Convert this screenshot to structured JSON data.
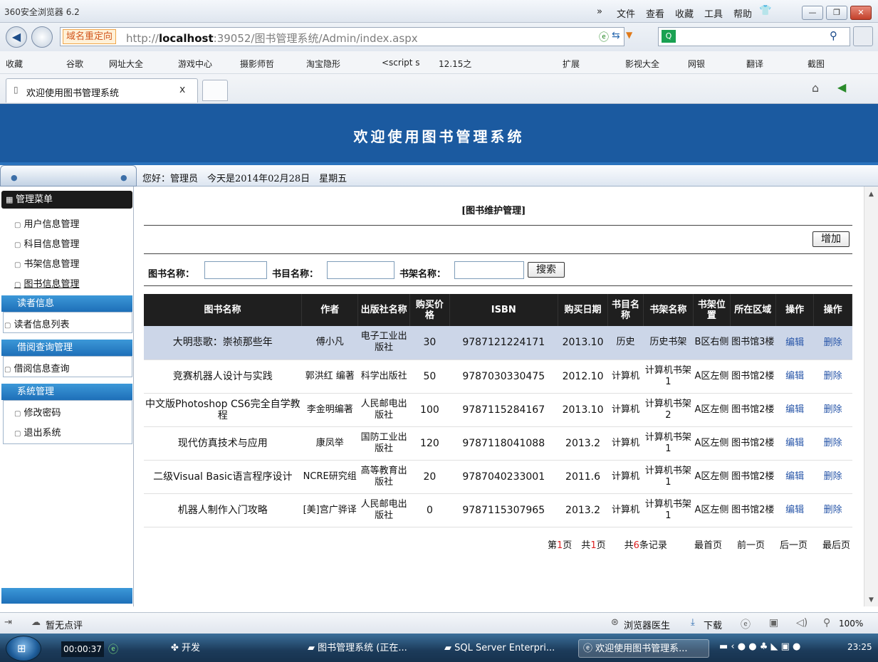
{
  "browser": {
    "title": "360安全浏览器 6.2",
    "menus": [
      "文件",
      "查看",
      "收藏",
      "工具",
      "帮助"
    ],
    "redirect_label": "域名重定向",
    "url_prefix": "http://",
    "url_host": "localhost",
    "url_rest": ":39052/图书管理系统/Admin/index.aspx",
    "chevrons": "»"
  },
  "favorites": [
    "收藏",
    "谷歌",
    "网址大全",
    "游戏中心",
    "摄影师哲",
    "淘宝隐形",
    "<script s",
    "12.15之",
    "扩展",
    "影视大全",
    "网银",
    "翻译",
    "截图"
  ],
  "tab": {
    "title": "欢迎使用图书管理系统",
    "close": "x"
  },
  "banner": {
    "title": "欢迎使用图书管理系统"
  },
  "welcome": {
    "text": "您好：管理员　今天是2014年02月28日　星期五"
  },
  "sidebar": {
    "menu_title": "管理菜单",
    "admin_items": [
      "用户信息管理",
      "科目信息管理",
      "书架信息管理",
      "图书信息管理"
    ],
    "reader_title": "读者信息",
    "reader_items": [
      "读者信息列表"
    ],
    "borrow_title": "借阅查询管理",
    "borrow_items": [
      "借阅信息查询"
    ],
    "system_title": "系统管理",
    "system_items": [
      "修改密码",
      "退出系统"
    ]
  },
  "page": {
    "heading": "[图书维护管理]",
    "add_button": "增加",
    "search_book_label": "图书名称：",
    "search_catalog_label": "书目名称：",
    "search_shelf_label": "书架名称：",
    "search_button": "搜索"
  },
  "table": {
    "headers": [
      "图书名称",
      "作者",
      "出版社名称",
      "购买价格",
      "ISBN",
      "购买日期",
      "书目名称",
      "书架名称",
      "书架位置",
      "所在区域",
      "操作",
      "操作"
    ],
    "edit_label": "编辑",
    "delete_label": "删除",
    "rows": [
      [
        "大明悲歌：崇祯那些年",
        "傅小凡",
        "电子工业出版社",
        "30",
        "9787121224171",
        "2013.10",
        "历史",
        "历史书架",
        "B区右侧",
        "图书馆3楼"
      ],
      [
        "竞赛机器人设计与实践",
        "郭洪红 编著",
        "科学出版社",
        "50",
        "9787030330475",
        "2012.10",
        "计算机",
        "计算机书架1",
        "A区左侧",
        "图书馆2楼"
      ],
      [
        "中文版Photoshop CS6完全自学教程",
        "李金明编著",
        "人民邮电出版社",
        "100",
        "9787115284167",
        "2013.10",
        "计算机",
        "计算机书架2",
        "A区左侧",
        "图书馆2楼"
      ],
      [
        "现代仿真技术与应用",
        "康凤举",
        "国防工业出版社",
        "120",
        "9787118041088",
        "2013.2",
        "计算机",
        "计算机书架1",
        "A区左侧",
        "图书馆2楼"
      ],
      [
        "二级Visual Basic语言程序设计",
        "NCRE研究组",
        "高等教育出版社",
        "20",
        "9787040233001",
        "2011.6",
        "计算机",
        "计算机书架1",
        "A区左侧",
        "图书馆2楼"
      ],
      [
        "机器人制作入门攻略",
        "[美]宫广骅译",
        "人民邮电出版社",
        "0",
        "9787115307965",
        "2013.2",
        "计算机",
        "计算机书架1",
        "A区左侧",
        "图书馆2楼"
      ]
    ]
  },
  "pager": {
    "p1": "第",
    "cur": "1",
    "p2": "页　共",
    "total": "1",
    "p3": "页　　共",
    "count": "6",
    "p4": "条记录",
    "first": "最首页",
    "prev": "前一页",
    "next": "后一页",
    "last": "最后页"
  },
  "status": {
    "left": "暂无点评",
    "doctor": "浏览器医生",
    "download": "下载",
    "zoom": "100%"
  },
  "taskbar": {
    "timer": "00:00:37",
    "items": [
      "开发",
      "图书管理系统 (正在...",
      "SQL Server Enterpri...",
      "欢迎使用图书管理系..."
    ],
    "clock": "23:25"
  }
}
